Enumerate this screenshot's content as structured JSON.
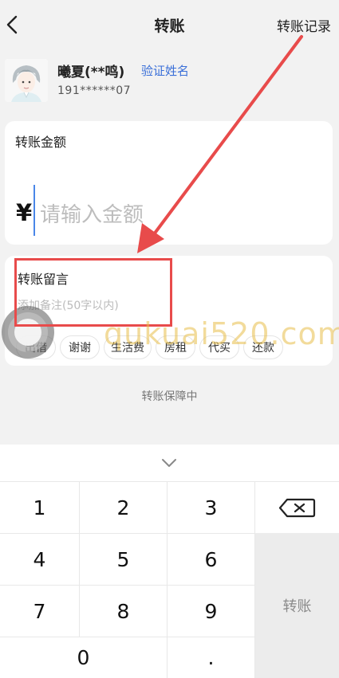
{
  "header": {
    "title": "转账",
    "records_label": "转账记录",
    "back_icon": "chevron-left-icon"
  },
  "recipient": {
    "name": "曦夏(**鸣)",
    "verify_label": "验证姓名",
    "phone": "191******07"
  },
  "amount": {
    "label": "转账金额",
    "currency_symbol": "¥",
    "placeholder": "请输入金额",
    "value": ""
  },
  "message": {
    "label": "转账留言",
    "placeholder": "添加备注(50字以内)",
    "chips": [
      "出借",
      "谢谢",
      "生活费",
      "房租",
      "代买",
      "还款"
    ]
  },
  "protection_text": "转账保障中",
  "keypad": {
    "keys": [
      "1",
      "2",
      "3",
      "4",
      "5",
      "6",
      "7",
      "8",
      "9",
      "0",
      "."
    ],
    "submit_label": "转账",
    "delete_icon": "backspace-icon",
    "collapse_icon": "chevron-down-icon"
  },
  "watermark": "qukuai520.com",
  "colors": {
    "accent": "#3a6fd8",
    "annotation": "#e84b4b",
    "caret": "#4a86e8"
  }
}
